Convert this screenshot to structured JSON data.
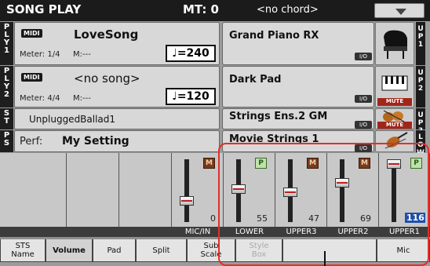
{
  "header": {
    "title": "SONG PLAY",
    "mt": "MT: 0",
    "chord": "<no chord>"
  },
  "player1": {
    "side": "P\nL\nY\n1",
    "midi": "MIDI",
    "song": "LoveSong",
    "meter": "Meter: 1/4",
    "measure": "M:---",
    "tempo": "♩=240"
  },
  "player2": {
    "side": "P\nL\nY\n2",
    "midi": "MIDI",
    "song": "<no song>",
    "meter": "Meter: 4/4",
    "measure": "M:---",
    "tempo": "♩=120"
  },
  "style": {
    "side": "S\nT",
    "name": "UnpluggedBallad1"
  },
  "performance": {
    "side": "P\nS",
    "label": "Perf:",
    "name": "My Setting"
  },
  "sounds": [
    {
      "name": "Grand Piano RX",
      "side": "U\nP\n1",
      "icon": "grand-piano-icon",
      "mute": ""
    },
    {
      "name": "Dark Pad",
      "side": "U\nP\n2",
      "icon": "pad-keyboard-icon",
      "mute": "MUTE"
    },
    {
      "name": "Strings Ens.2 GM",
      "side": "U\nP\n3",
      "icon": "strings-ensemble-icon",
      "mute": "MUTE"
    },
    {
      "name": "Movie Strings 1",
      "side": "L\nO\nW",
      "icon": "violin-icon",
      "mute": ""
    }
  ],
  "io_label": "I/O",
  "mixer": {
    "channels": [
      {
        "label": "",
        "value": "",
        "button": ""
      },
      {
        "label": "",
        "value": "",
        "button": ""
      },
      {
        "label": "",
        "value": "",
        "button": ""
      },
      {
        "label": "MIC/IN",
        "value": "0",
        "button": "M"
      },
      {
        "label": "LOWER",
        "value": "55",
        "button": "P"
      },
      {
        "label": "UPPER3",
        "value": "47",
        "button": "M"
      },
      {
        "label": "UPPER2",
        "value": "69",
        "button": "M"
      },
      {
        "label": "UPPER1",
        "value": "116",
        "button": "P"
      }
    ]
  },
  "tabs": [
    {
      "label": "STS\nName"
    },
    {
      "label": "Volume"
    },
    {
      "label": "Pad"
    },
    {
      "label": "Split"
    },
    {
      "label": "Sub\nScale"
    },
    {
      "label": "Style\nBox"
    },
    {
      "label": ""
    },
    {
      "label": "Mic"
    }
  ],
  "colors": {
    "highlight": "#e0302a",
    "mute_red": "#a0261a",
    "play_green": "#bfe2a8",
    "header_dark": "#1b1b1b"
  }
}
